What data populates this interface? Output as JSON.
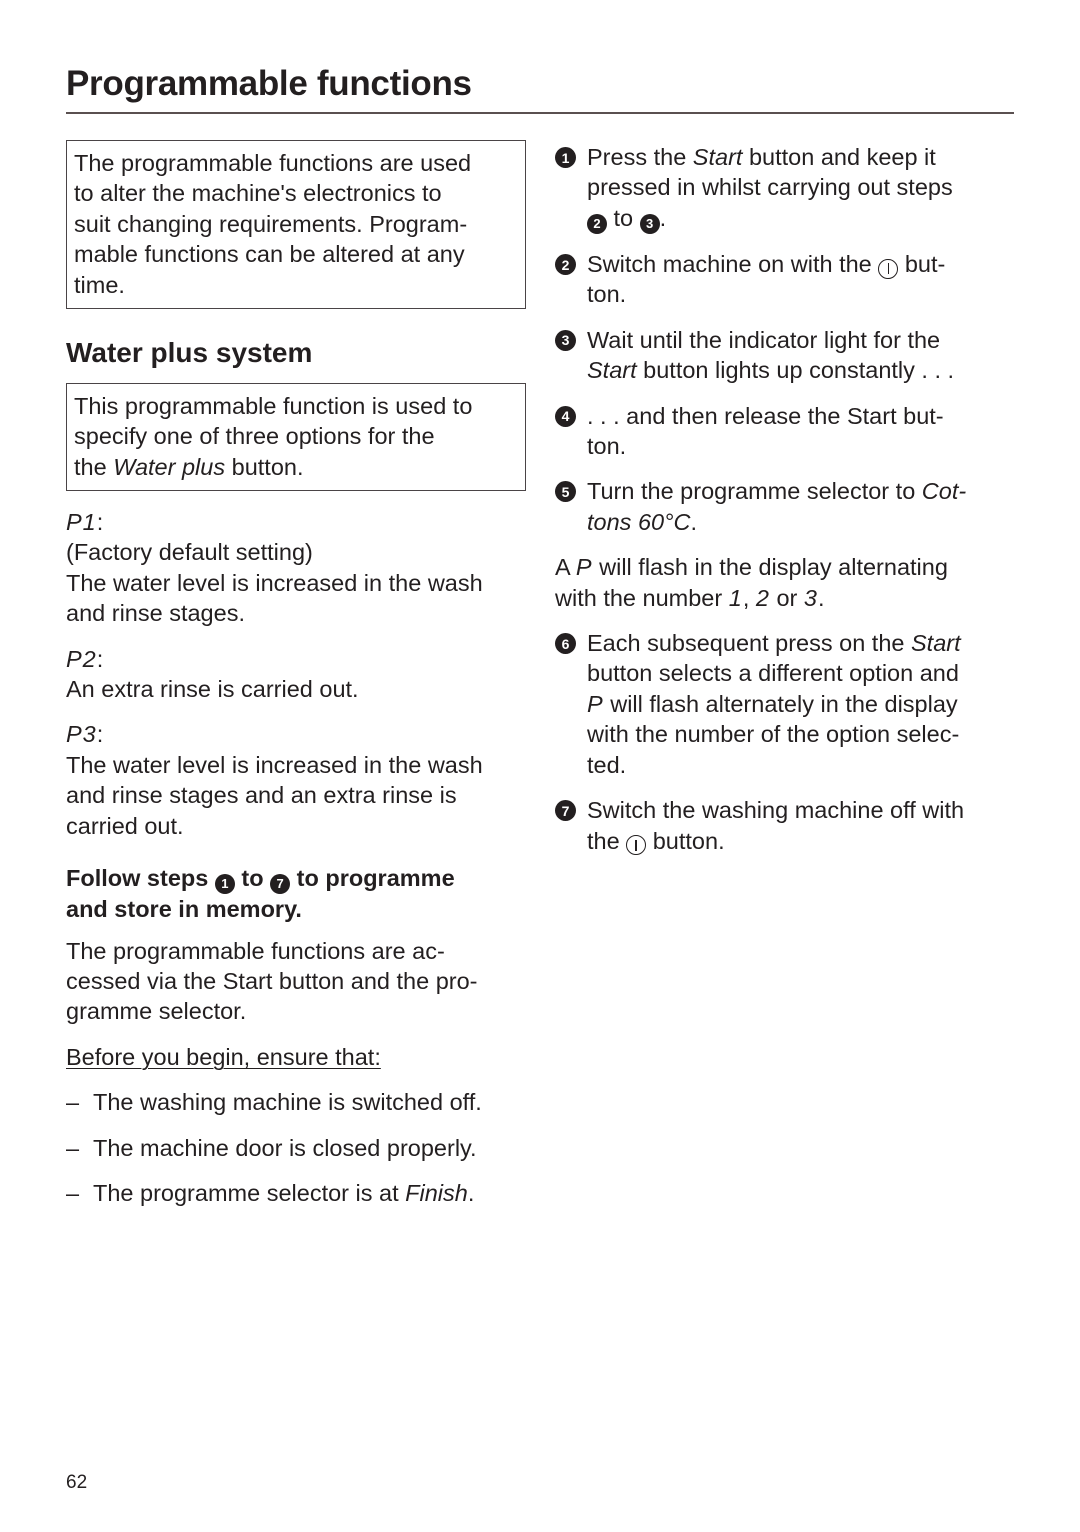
{
  "header": {
    "title": "Programmable functions"
  },
  "intro_box": {
    "lines": [
      "The programmable functions are used",
      "to alter the machine's electronics to",
      "suit changing requirements. Program-",
      "mable functions can be altered at any",
      "time."
    ]
  },
  "section": {
    "title": "Water plus system",
    "box": {
      "line1": "This programmable function is used to",
      "line2": "specify one of three options for the",
      "line3_pre": "the ",
      "line3_it": "Water plus",
      "line3_post": " button."
    },
    "options": [
      {
        "code": "P1",
        "colon": ":",
        "lines": [
          "(Factory default setting)",
          "The water level is increased in the wash",
          "and rinse stages."
        ]
      },
      {
        "code": "P2",
        "colon": ":",
        "lines": [
          "An extra rinse is carried out."
        ]
      },
      {
        "code": "P3",
        "colon": ":",
        "lines": [
          "The water level is increased in the wash",
          "and rinse stages and an extra rinse is",
          "carried out."
        ]
      }
    ],
    "follow": {
      "pre": "Follow steps ",
      "n1": "1",
      "mid": " to ",
      "n2": "7",
      "post1": " to programme",
      "post2": "and store in memory."
    },
    "access": [
      "The programmable functions are ac-",
      "cessed via the Start button and the pro-",
      "gramme selector."
    ],
    "before": "Before you begin, ensure that:",
    "checks": [
      {
        "dash": "–",
        "text": "The washing machine is switched off."
      },
      {
        "dash": "–",
        "text": "The machine door is closed properly."
      },
      {
        "dash": "–",
        "text_pre": "The programme selector is at ",
        "text_it": "Finish",
        "text_post": "."
      }
    ]
  },
  "steps": {
    "s1": {
      "num": "1",
      "pre": "Press the ",
      "it": "Start",
      "post": " button and keep it",
      "line2": "pressed in whilst carrying out steps",
      "n_a": "2",
      "to": " to ",
      "n_b": "3",
      "end": "."
    },
    "s2": {
      "num": "2",
      "pre": "Switch machine on with the ",
      "post": " but-",
      "line2": "ton.",
      "icon": "power-icon"
    },
    "s3": {
      "num": "3",
      "line1": "Wait until the indicator light for the",
      "it": "Start",
      "post": " button lights up constantly . . ."
    },
    "s4": {
      "num": "4",
      "line1": ". . . and then release the Start but-",
      "line2": "ton."
    },
    "s5": {
      "num": "5",
      "pre": "Turn the programme selector to ",
      "it1": "Cot-",
      "it2": "tons 60°C",
      "end": "."
    },
    "flash": {
      "pre": "A ",
      "P": "P",
      "post": " will flash in the display alternating",
      "line2_pre": "with the number ",
      "n1": "1",
      "c1": ", ",
      "n2": "2",
      "or": " or ",
      "n3": "3",
      "end": "."
    },
    "s6": {
      "num": "6",
      "pre": "Each subsequent press on the ",
      "it": "Start",
      "line2": "button selects a different option and",
      "P": "P",
      "line3": " will flash alternately in the display",
      "line4": "with the number of the option selec-",
      "line5": "ted."
    },
    "s7": {
      "num": "7",
      "line1": "Switch the washing machine off with",
      "pre": "the ",
      "post": " button.",
      "icon": "power-icon"
    }
  },
  "footer": {
    "page_number": "62"
  }
}
